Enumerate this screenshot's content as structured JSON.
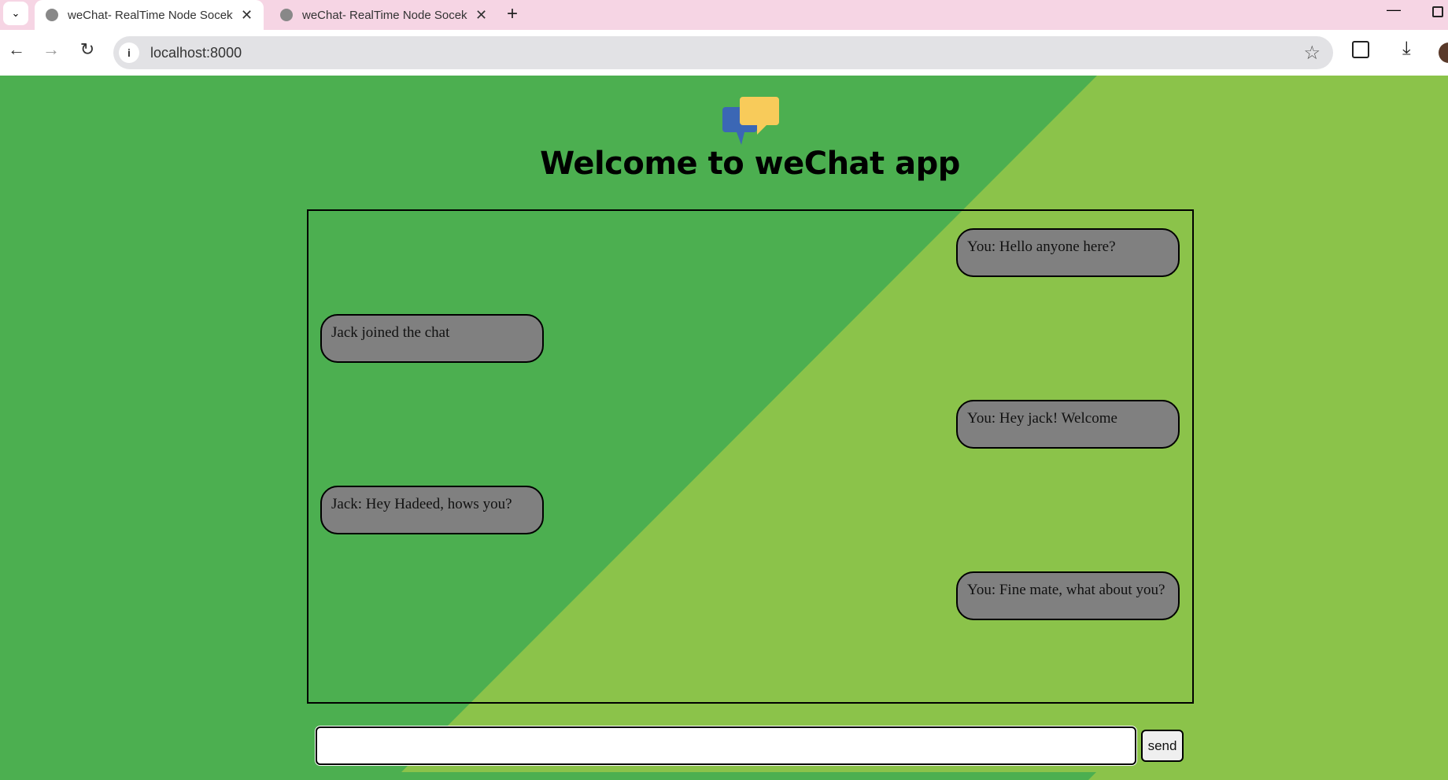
{
  "browser": {
    "tabs": [
      {
        "title": "weChat- RealTime Node Socekt",
        "active": true
      },
      {
        "title": "weChat- RealTime Node Socekt",
        "active": false
      }
    ],
    "url": "localhost:8000"
  },
  "colors": {
    "bg_dark": "#4caf50",
    "bg_light": "#8bc34a",
    "bubble": "#808080"
  },
  "header": {
    "title": "Welcome to weChat app",
    "logo_icon": "chat-bubbles-icon"
  },
  "messages": [
    {
      "text": "You: Hello anyone here?",
      "side": "right"
    },
    {
      "text": "Jack joined the chat",
      "side": "left"
    },
    {
      "text": "You: Hey jack! Welcome",
      "side": "right"
    },
    {
      "text": "Jack: Hey Hadeed, hows you?",
      "side": "left"
    },
    {
      "text": "You: Fine mate, what about you?",
      "side": "right"
    }
  ],
  "composer": {
    "value": "",
    "send_label": "send"
  }
}
